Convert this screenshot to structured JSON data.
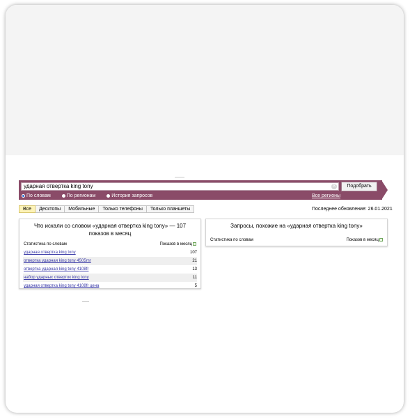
{
  "search": {
    "query": "ударная отвертка king tony",
    "submit_label": "Подобрать",
    "modes": [
      {
        "label": "По словам",
        "selected": true
      },
      {
        "label": "По регионам",
        "selected": false
      },
      {
        "label": "История запросов",
        "selected": false
      }
    ],
    "all_regions_label": "Все регионы"
  },
  "device_tabs": [
    {
      "label": "Все",
      "active": true
    },
    {
      "label": "Десктопы",
      "active": false
    },
    {
      "label": "Мобильные",
      "active": false
    },
    {
      "label": "Только телефоны",
      "active": false
    },
    {
      "label": "Только планшеты",
      "active": false
    }
  ],
  "last_update": "Последнее обновление: 26.01.2021",
  "left_panel": {
    "title": "Что искали со словом «ударная отвертка king tony» — 107 показов в месяц",
    "col_stats": "Статистика по словам",
    "col_impressions": "Показов в месяц",
    "rows": [
      {
        "phrase": "ударная отвертка king tony",
        "count": "107"
      },
      {
        "phrase": "отвертка ударная king tony 4505mr",
        "count": "21"
      },
      {
        "phrase": "отвертка ударная king tony 4108fr",
        "count": "13"
      },
      {
        "phrase": "набор ударных отверток king tony",
        "count": "11"
      },
      {
        "phrase": "ударная отвертка king tony 4108fr цена",
        "count": "5"
      }
    ]
  },
  "right_panel": {
    "title": "Запросы, похожие на «ударная отвертка king tony»",
    "col_stats": "Статистика по словам",
    "col_impressions": "Показов в месяц"
  },
  "colors": {
    "bar": "#8a4b68",
    "active_tab": "#fdf3b8",
    "link": "#3b3ba8",
    "gray_area": "#f4f4f4"
  }
}
